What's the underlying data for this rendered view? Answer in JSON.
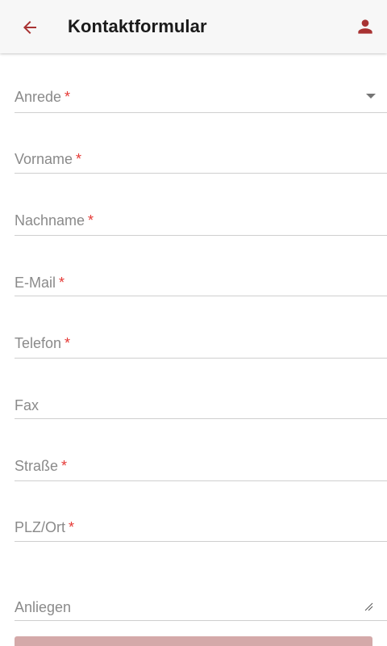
{
  "header": {
    "title": "Kontaktformular",
    "back_icon": "arrow-left-icon",
    "profile_icon": "person-icon"
  },
  "form": {
    "fields": {
      "anrede": {
        "label": "Anrede",
        "required": "*"
      },
      "vorname": {
        "label": "Vorname",
        "required": "*"
      },
      "nachname": {
        "label": "Nachname",
        "required": "*"
      },
      "email": {
        "label": "E-Mail",
        "required": "*"
      },
      "telefon": {
        "label": "Telefon",
        "required": "*"
      },
      "fax": {
        "label": "Fax"
      },
      "strasse": {
        "label": "Straße",
        "required": "*"
      },
      "plz_ort": {
        "label": "PLZ/Ort",
        "required": "*"
      },
      "anliegen": {
        "label": "Anliegen"
      }
    }
  },
  "colors": {
    "accent": "#a83232",
    "required": "#e53935",
    "button": "#d4a9a9"
  }
}
